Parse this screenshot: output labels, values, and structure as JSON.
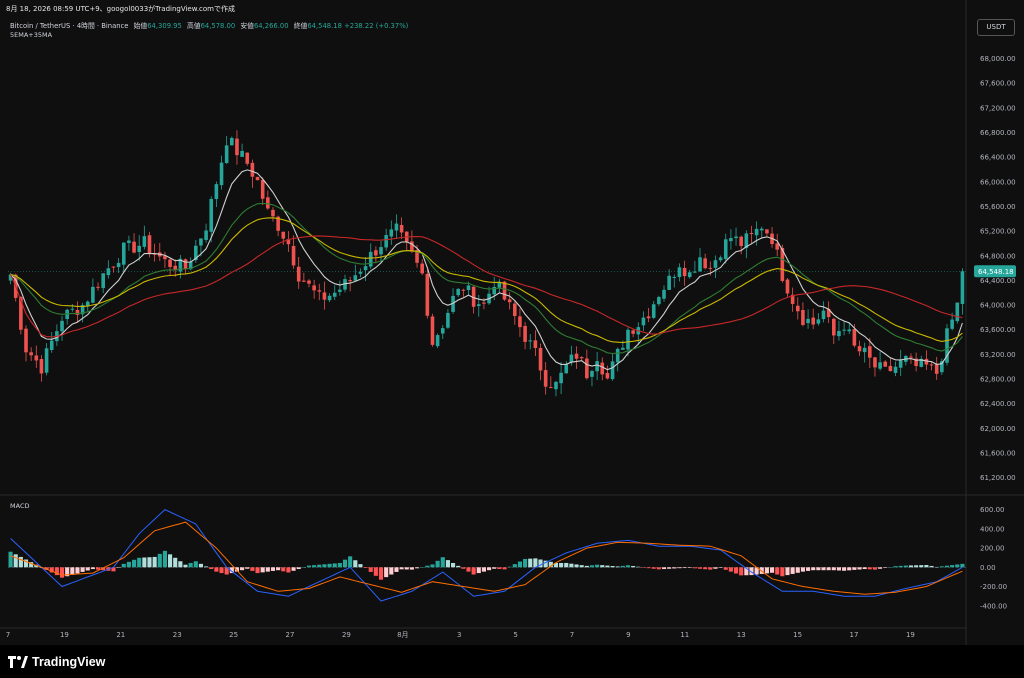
{
  "header": {
    "snapshot_line": "8月 18, 2026 08:59 UTC+9、googol0033がTradingView.comで作成",
    "symbol": "Bitcoin / TetherUS · 4時間 · Binance",
    "open_label": "始値",
    "open": "64,309.95",
    "high_label": "高値",
    "high": "64,578.00",
    "low_label": "安値",
    "low": "64,266.00",
    "close_label": "終値",
    "close": "64,548.18",
    "change": "+238.22 (+0.37%)",
    "indicator_label": "5EMA+35MA",
    "currency_button": "USDT"
  },
  "macd_pane": {
    "label": "MACD"
  },
  "branding": {
    "logo_text": "TradingView",
    "logo_icon": "tradingview-logo-icon"
  },
  "colors": {
    "bg": "#0f0f0f",
    "up": "#26a69a",
    "down": "#ef5350",
    "ema": "#d1d1d1",
    "green_ma": "#2e7d32",
    "yellow_ma": "#c9b800",
    "red_ma": "#c62828",
    "macd": "#2962ff",
    "signal": "#ff6d00"
  },
  "chart_data": [
    {
      "type": "candlestick",
      "title": "Bitcoin / TetherUS · 4時間 · Binance",
      "y_ticks": [
        "68,000.00",
        "67,600.00",
        "67,200.00",
        "66,800.00",
        "66,400.00",
        "66,000.00",
        "65,600.00",
        "65,200.00",
        "64,800.00",
        "64,400.00",
        "64,000.00",
        "63,600.00",
        "63,200.00",
        "62,800.00",
        "62,400.00",
        "62,000.00",
        "61,600.00",
        "61,200.00"
      ],
      "ylim": [
        61000,
        68300
      ],
      "last_price_label": "64,548.18",
      "last_price": 64548.18,
      "x_ticks": [
        "7",
        "19",
        "21",
        "23",
        "25",
        "27",
        "29",
        "8月",
        "3",
        "5",
        "7",
        "9",
        "11",
        "13",
        "15",
        "17",
        "19"
      ],
      "close_path": [
        [
          0,
          64500
        ],
        [
          3,
          63300
        ],
        [
          6,
          63000
        ],
        [
          10,
          63800
        ],
        [
          14,
          64000
        ],
        [
          18,
          64500
        ],
        [
          22,
          64900
        ],
        [
          26,
          65000
        ],
        [
          30,
          64700
        ],
        [
          34,
          64600
        ],
        [
          38,
          65300
        ],
        [
          40,
          66000
        ],
        [
          42,
          66700
        ],
        [
          44,
          66500
        ],
        [
          46,
          66300
        ],
        [
          48,
          66000
        ],
        [
          50,
          65500
        ],
        [
          52,
          65300
        ],
        [
          54,
          65000
        ],
        [
          56,
          64500
        ],
        [
          58,
          64300
        ],
        [
          60,
          64100
        ],
        [
          63,
          64200
        ],
        [
          66,
          64400
        ],
        [
          69,
          64700
        ],
        [
          72,
          65000
        ],
        [
          75,
          65200
        ],
        [
          78,
          64800
        ],
        [
          80,
          64500
        ],
        [
          82,
          63400
        ],
        [
          84,
          63700
        ],
        [
          86,
          64100
        ],
        [
          88,
          64300
        ],
        [
          90,
          64100
        ],
        [
          92,
          64000
        ],
        [
          94,
          64400
        ],
        [
          96,
          64100
        ],
        [
          98,
          63800
        ],
        [
          100,
          63500
        ],
        [
          102,
          63200
        ],
        [
          104,
          62800
        ],
        [
          106,
          62700
        ],
        [
          108,
          63000
        ],
        [
          110,
          63200
        ],
        [
          112,
          62900
        ],
        [
          114,
          63200
        ],
        [
          116,
          62800
        ],
        [
          118,
          63200
        ],
        [
          120,
          63600
        ],
        [
          122,
          63700
        ],
        [
          124,
          63900
        ],
        [
          126,
          64200
        ],
        [
          128,
          64400
        ],
        [
          130,
          64700
        ],
        [
          132,
          64500
        ],
        [
          134,
          64800
        ],
        [
          136,
          64600
        ],
        [
          138,
          64900
        ],
        [
          140,
          65100
        ],
        [
          142,
          65000
        ],
        [
          144,
          65100
        ],
        [
          146,
          65300
        ],
        [
          148,
          65100
        ],
        [
          150,
          64500
        ],
        [
          152,
          64100
        ],
        [
          154,
          63800
        ],
        [
          156,
          63700
        ],
        [
          158,
          63900
        ],
        [
          160,
          63500
        ],
        [
          162,
          63700
        ],
        [
          164,
          63300
        ],
        [
          166,
          63200
        ],
        [
          168,
          63000
        ],
        [
          170,
          62900
        ],
        [
          172,
          63000
        ],
        [
          174,
          63100
        ],
        [
          176,
          63000
        ],
        [
          178,
          63000
        ],
        [
          180,
          62900
        ],
        [
          182,
          63500
        ],
        [
          184,
          64000
        ],
        [
          185,
          64548
        ]
      ],
      "series": [
        {
          "name": "5EMA",
          "color": "#d1d1d1"
        },
        {
          "name": "35MA",
          "color": "#c62828"
        }
      ]
    },
    {
      "type": "macd",
      "title": "MACD",
      "y_ticks": [
        "600.00",
        "400.00",
        "200.00",
        "0.00",
        "-200.00",
        "-400.00"
      ],
      "ylim": [
        -600,
        700
      ],
      "macd_path": [
        [
          0,
          300
        ],
        [
          10,
          -200
        ],
        [
          15,
          -100
        ],
        [
          20,
          0
        ],
        [
          25,
          350
        ],
        [
          30,
          600
        ],
        [
          36,
          450
        ],
        [
          42,
          0
        ],
        [
          48,
          -250
        ],
        [
          54,
          -300
        ],
        [
          60,
          -150
        ],
        [
          66,
          0
        ],
        [
          72,
          -350
        ],
        [
          78,
          -250
        ],
        [
          84,
          -50
        ],
        [
          90,
          -300
        ],
        [
          96,
          -250
        ],
        [
          102,
          0
        ],
        [
          108,
          150
        ],
        [
          114,
          250
        ],
        [
          120,
          280
        ],
        [
          126,
          220
        ],
        [
          132,
          220
        ],
        [
          138,
          180
        ],
        [
          144,
          -50
        ],
        [
          150,
          -250
        ],
        [
          156,
          -250
        ],
        [
          162,
          -300
        ],
        [
          168,
          -300
        ],
        [
          174,
          -220
        ],
        [
          180,
          -150
        ],
        [
          185,
          0
        ]
      ],
      "signal_path": [
        [
          0,
          120
        ],
        [
          10,
          -80
        ],
        [
          16,
          -60
        ],
        [
          22,
          100
        ],
        [
          28,
          380
        ],
        [
          34,
          470
        ],
        [
          40,
          200
        ],
        [
          46,
          -150
        ],
        [
          52,
          -250
        ],
        [
          58,
          -220
        ],
        [
          64,
          -100
        ],
        [
          70,
          -180
        ],
        [
          76,
          -260
        ],
        [
          82,
          -150
        ],
        [
          88,
          -200
        ],
        [
          94,
          -250
        ],
        [
          100,
          -180
        ],
        [
          106,
          50
        ],
        [
          112,
          200
        ],
        [
          118,
          260
        ],
        [
          124,
          250
        ],
        [
          130,
          230
        ],
        [
          136,
          220
        ],
        [
          142,
          120
        ],
        [
          148,
          -120
        ],
        [
          154,
          -200
        ],
        [
          160,
          -250
        ],
        [
          166,
          -280
        ],
        [
          172,
          -260
        ],
        [
          178,
          -200
        ],
        [
          185,
          -40
        ]
      ]
    }
  ]
}
